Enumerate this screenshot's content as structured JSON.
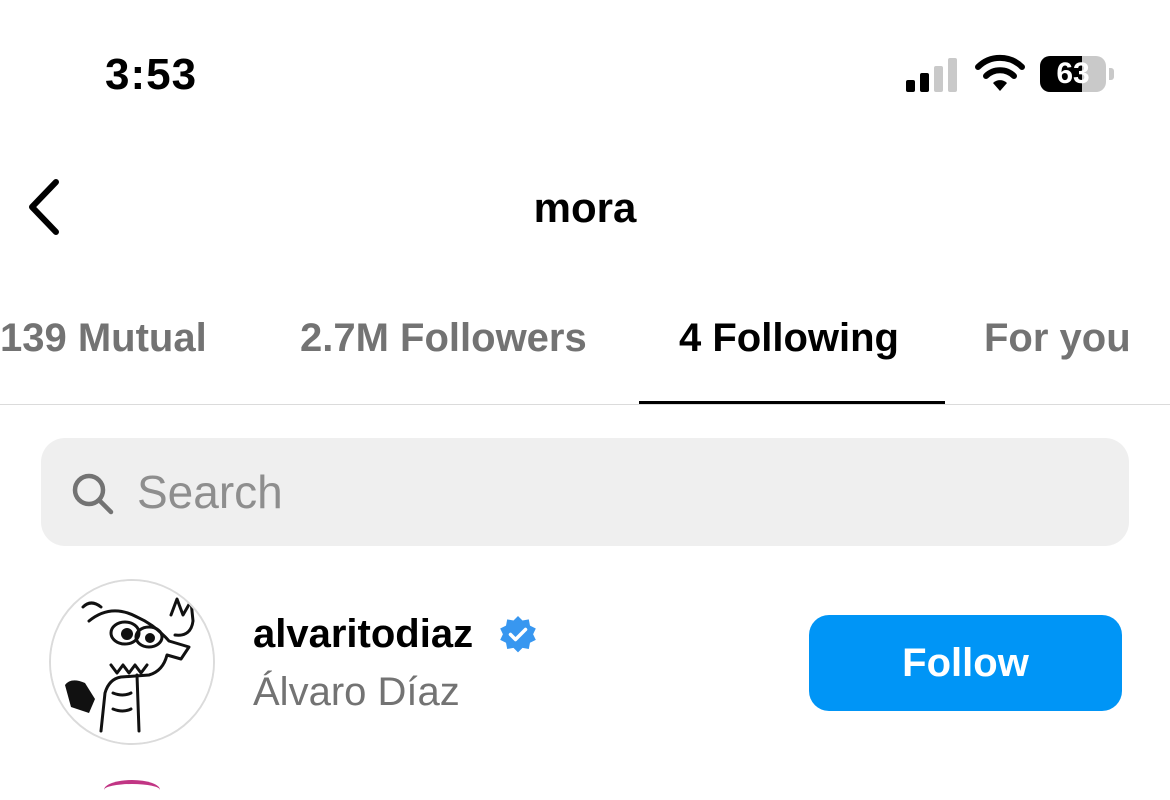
{
  "status_bar": {
    "time": "3:53",
    "battery_level": "63",
    "battery_fraction": 0.63,
    "signal_bars_active": 2,
    "signal_bars_total": 4
  },
  "header": {
    "title": "mora",
    "back_icon": "chevron-left-icon"
  },
  "tabs": [
    {
      "label": "139 Mutual",
      "active": false
    },
    {
      "label": "2.7M Followers",
      "active": false
    },
    {
      "label": "4 Following",
      "active": true
    },
    {
      "label": "For you",
      "active": false
    }
  ],
  "search": {
    "placeholder": "Search",
    "value": "",
    "icon": "search-icon"
  },
  "users": [
    {
      "username": "alvaritodiaz",
      "full_name": "Álvaro Díaz",
      "verified": true,
      "button_label": "Follow"
    }
  ],
  "colors": {
    "accent": "#0095f6",
    "verified_badge": "#3897f0",
    "secondary_text": "#737373",
    "search_bg": "#efefef",
    "divider": "#dbdbdb"
  }
}
